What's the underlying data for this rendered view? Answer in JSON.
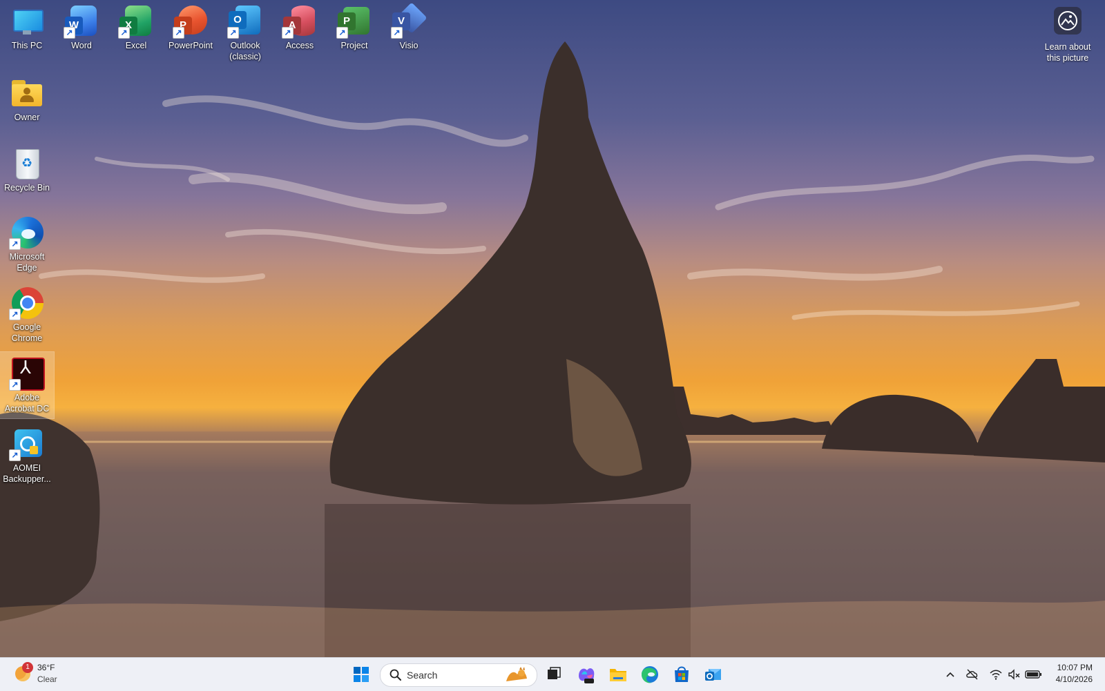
{
  "desktop": {
    "icons": [
      {
        "label": "This PC",
        "icon": "this-pc-icon"
      },
      {
        "label": "Word",
        "icon": "word-icon"
      },
      {
        "label": "Excel",
        "icon": "excel-icon"
      },
      {
        "label": "PowerPoint",
        "icon": "powerpoint-icon"
      },
      {
        "label": "Outlook (classic)",
        "icon": "outlook-icon"
      },
      {
        "label": "Access",
        "icon": "access-icon"
      },
      {
        "label": "Project",
        "icon": "project-icon"
      },
      {
        "label": "Visio",
        "icon": "visio-icon"
      },
      {
        "label": "Owner",
        "icon": "user-folder-icon"
      },
      {
        "label": "Recycle Bin",
        "icon": "recycle-bin-icon"
      },
      {
        "label": "Microsoft Edge",
        "icon": "edge-icon"
      },
      {
        "label": "Google Chrome",
        "icon": "chrome-icon"
      },
      {
        "label": "Adobe Acrobat DC",
        "icon": "acrobat-icon"
      },
      {
        "label": "AOMEI Backupper...",
        "icon": "aomei-icon"
      }
    ],
    "learn_label": "Learn about this picture"
  },
  "taskbar": {
    "weather": {
      "temp": "36°F",
      "condition": "Clear",
      "badge": "1"
    },
    "search": {
      "placeholder": "Search"
    },
    "clock": {
      "time": "10:07 PM",
      "date": "4/10/2026"
    }
  },
  "colors": {
    "accent": "#0067c0",
    "word": "#185abd",
    "excel": "#107c41",
    "powerpoint": "#c43e1c",
    "outlook": "#0f6cbd",
    "access": "#a4373a",
    "project": "#31752f",
    "visio": "#3955a3"
  }
}
